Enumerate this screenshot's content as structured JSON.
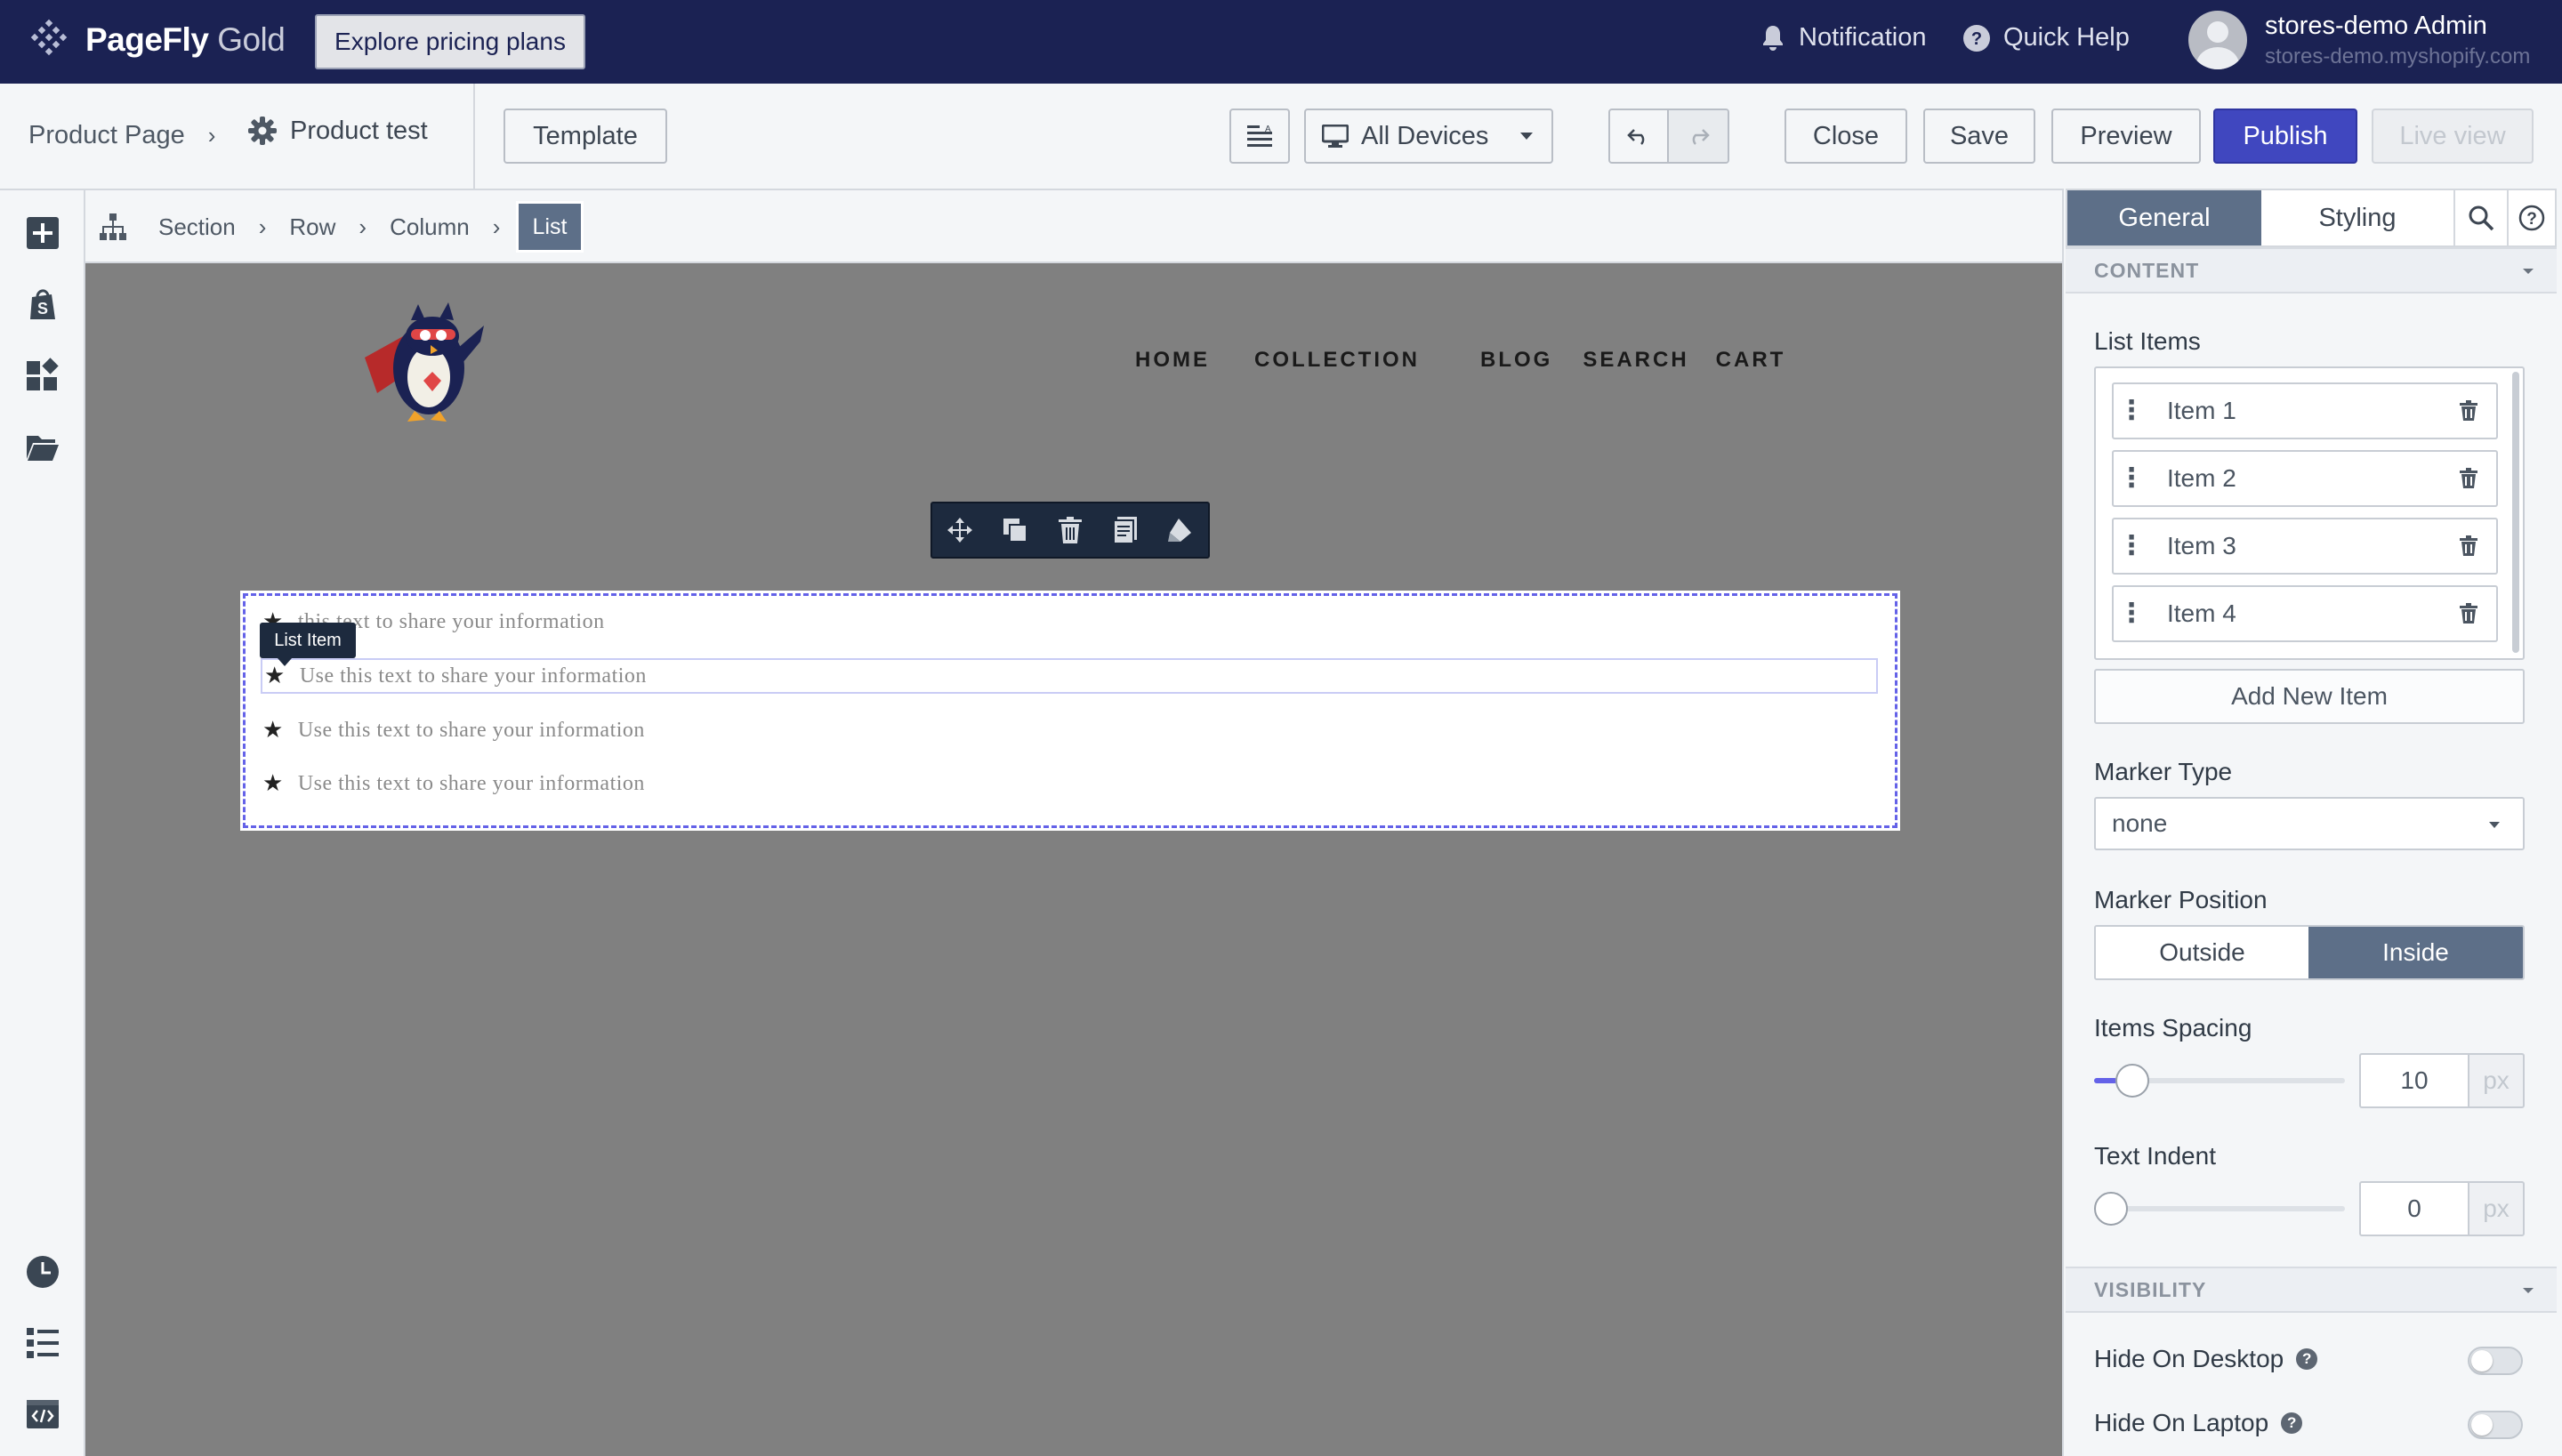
{
  "app": {
    "brand": "PageFly",
    "tier": "Gold",
    "explore_label": "Explore pricing plans",
    "notification_label": "Notification",
    "help_label": "Quick Help",
    "user_name": "stores-demo Admin",
    "user_store": "stores-demo.myshopify.com"
  },
  "toolbar": {
    "page_type": "Product Page",
    "page_name": "Product test",
    "template_label": "Template",
    "device_label": "All Devices",
    "close_label": "Close",
    "save_label": "Save",
    "preview_label": "Preview",
    "publish_label": "Publish",
    "liveview_label": "Live view"
  },
  "breadcrumb": {
    "items": [
      "Section",
      "Row",
      "Column"
    ],
    "active": "List"
  },
  "store_nav": [
    "HOME",
    "COLLECTION",
    "BLOG",
    "SEARCH",
    "CART"
  ],
  "canvas": {
    "tooltip": "List Item",
    "partial_first": "this text to share your information",
    "list_text": "Use this text to share your information"
  },
  "panel": {
    "tabs": [
      "General",
      "Styling"
    ],
    "content_header": "CONTENT",
    "list_items_label": "List Items",
    "list_items": [
      "Item 1",
      "Item 2",
      "Item 3",
      "Item 4"
    ],
    "add_item_label": "Add New Item",
    "marker_type_label": "Marker Type",
    "marker_type_value": "none",
    "marker_position_label": "Marker Position",
    "marker_position_options": [
      "Outside",
      "Inside"
    ],
    "marker_position_selected": "Inside",
    "spacing_label": "Items Spacing",
    "spacing_value": "10",
    "indent_label": "Text Indent",
    "indent_value": "0",
    "unit": "px",
    "visibility_header": "VISIBILITY",
    "hide_desktop_label": "Hide On Desktop",
    "hide_laptop_label": "Hide On Laptop"
  },
  "colors": {
    "topbar": "#1b2253",
    "publish": "#4047bf",
    "tab_active": "#5d6f88",
    "selection": "#6462e8"
  }
}
